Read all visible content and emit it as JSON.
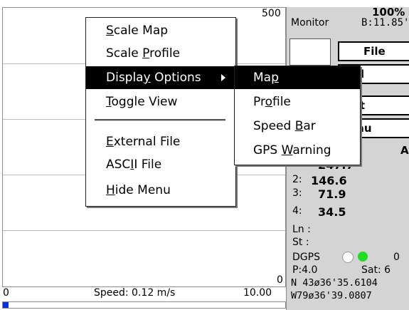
{
  "plot": {
    "y_max_label": "500",
    "y_min_label": "0",
    "x_min_label": "0",
    "x_max_label": "10.00",
    "speed_label": "Speed: 0.12 m/s",
    "speed_fraction": 0.012
  },
  "panel": {
    "battery_pct": "100%",
    "monitor_label": "Monitor",
    "battery_voltage": "B:11.85'",
    "file_button": "File",
    "pull_button": "ull",
    "exit_button": "xit",
    "menu_button": "enu",
    "a_label": "A",
    "readings": [
      {
        "index": "1:",
        "value": "247.7"
      },
      {
        "index": "2:",
        "value": "146.6"
      },
      {
        "index": "3:",
        "value": "71.9"
      },
      {
        "index": "4:",
        "value": "34.5"
      }
    ],
    "ln_label": "Ln :",
    "st_label": "St :",
    "dgps_label": "DGPS",
    "dgps_count": "0",
    "dgps_light_colors": [
      "#ffffff",
      "#22dd22"
    ],
    "p_label": "P:4.0",
    "sat_label": "Sat: 6",
    "lat": "N 43ø36'35.6104",
    "lon": "W79ø36'39.0807"
  },
  "context_menu": {
    "items": [
      {
        "pre": "",
        "u": "S",
        "post": "cale Map"
      },
      {
        "pre": "Scale ",
        "u": "P",
        "post": "rofile"
      },
      {
        "pre": "Displa",
        "u": "y",
        "post": " Options"
      },
      {
        "pre": "",
        "u": "T",
        "post": "oggle View"
      },
      {
        "pre": "",
        "u": "E",
        "post": "xternal File"
      },
      {
        "pre": "ASC",
        "u": "I",
        "post": "I File"
      },
      {
        "pre": "",
        "u": "H",
        "post": "ide Menu"
      }
    ]
  },
  "submenu": {
    "items": [
      {
        "pre": "Ma",
        "u": "p",
        "post": ""
      },
      {
        "pre": "Pr",
        "u": "o",
        "post": "file"
      },
      {
        "pre": "Speed ",
        "u": "B",
        "post": "ar"
      },
      {
        "pre": "GPS ",
        "u": "W",
        "post": "arning"
      }
    ]
  },
  "colors": {
    "speed_fill": "#0a2fd4",
    "panel_bg": "#d4d4d4",
    "highlight": "#000000"
  }
}
